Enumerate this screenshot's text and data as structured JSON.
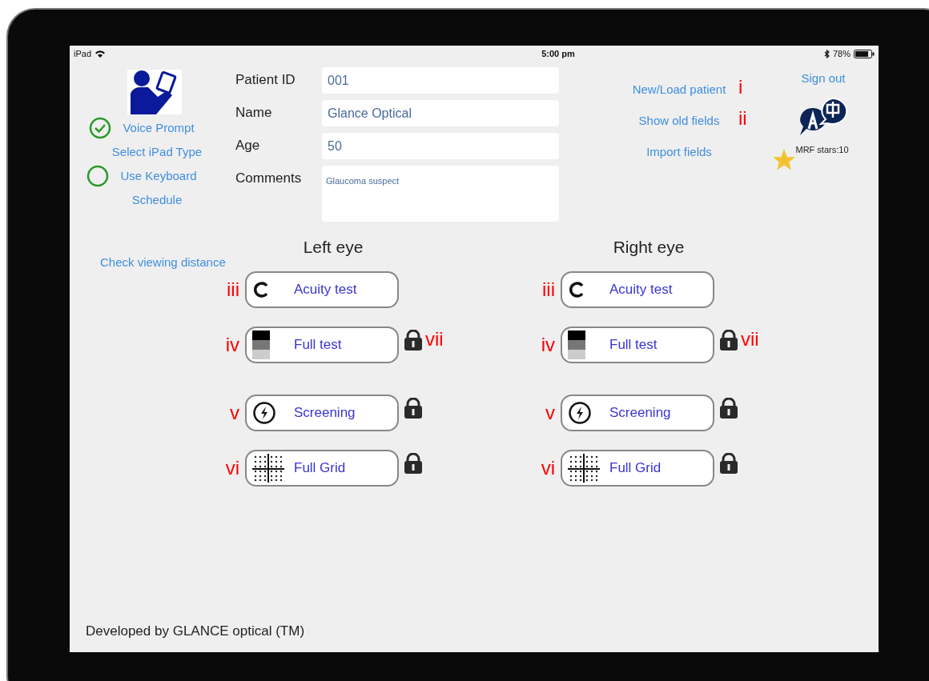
{
  "status_bar": {
    "device": "iPad",
    "time": "5:00 pm",
    "battery": "78%"
  },
  "sidebar": {
    "items": [
      {
        "label": "Voice Prompt",
        "kind": "toggle",
        "checked": true
      },
      {
        "label": "Select iPad Type",
        "kind": "link"
      },
      {
        "label": "Use Keyboard",
        "kind": "toggle",
        "checked": false
      },
      {
        "label": "Schedule",
        "kind": "link"
      }
    ],
    "distance_link": "Check viewing distance"
  },
  "form": {
    "fields": [
      {
        "label": "Patient ID",
        "value": "001",
        "kind": "input"
      },
      {
        "label": "Name",
        "value": "Glance Optical",
        "kind": "input"
      },
      {
        "label": "Age",
        "value": "50",
        "kind": "input"
      },
      {
        "label": "Comments",
        "value": "Glaucoma suspect",
        "kind": "textarea"
      }
    ]
  },
  "actions": [
    {
      "label": "New/Load patient",
      "annotation": "i"
    },
    {
      "label": "Show old fields",
      "annotation": "ii"
    },
    {
      "label": "Import fields"
    }
  ],
  "sign_out": "Sign out",
  "stars_label": "MRF stars:10",
  "eyes": [
    {
      "title": "Left eye",
      "tests": [
        {
          "label": "Acuity test",
          "kind": "acuity",
          "annotation": "iii",
          "locked": false
        },
        {
          "label": "Full test",
          "kind": "gradient",
          "annotation": "iv",
          "locked": true,
          "lock_annotation": "vii"
        },
        {
          "label": "Screening",
          "kind": "screening",
          "annotation": "v",
          "locked": true
        },
        {
          "label": "Full Grid",
          "kind": "grid",
          "annotation": "vi",
          "locked": true
        }
      ]
    },
    {
      "title": "Right eye",
      "tests": [
        {
          "label": "Acuity test",
          "kind": "acuity",
          "annotation": "iii",
          "locked": false
        },
        {
          "label": "Full test",
          "kind": "gradient",
          "annotation": "iv",
          "locked": true,
          "lock_annotation": "vii"
        },
        {
          "label": "Screening",
          "kind": "screening",
          "annotation": "v",
          "locked": true
        },
        {
          "label": "Full Grid",
          "kind": "grid",
          "annotation": "vi",
          "locked": true
        }
      ]
    }
  ],
  "footer": "Developed by GLANCE optical (TM)"
}
